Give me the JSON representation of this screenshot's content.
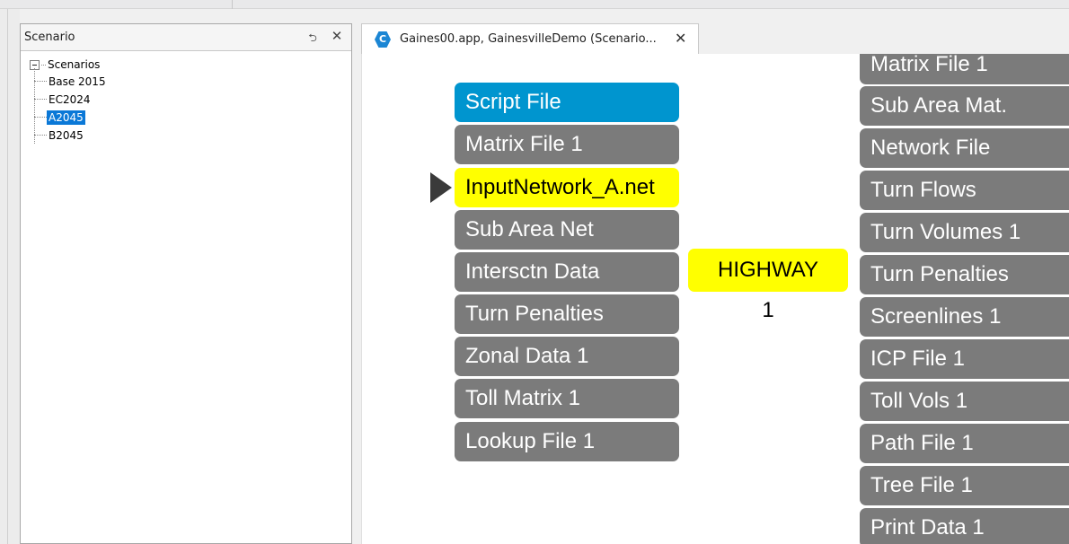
{
  "scenario_panel": {
    "title": "Scenario",
    "pin_glyph": "⮌",
    "close_glyph": "✕",
    "tree": {
      "root_label": "Scenarios",
      "items": [
        {
          "label": "Base 2015",
          "selected": false
        },
        {
          "label": "EC2024",
          "selected": false
        },
        {
          "label": "A2045",
          "selected": true
        },
        {
          "label": "B2045",
          "selected": false
        }
      ]
    }
  },
  "document_tab": {
    "icon_letter": "C",
    "label": "Gaines00.app, GainesvilleDemo (Scenario...",
    "close_glyph": "✕"
  },
  "flowchart": {
    "input_files": [
      {
        "label": "Script File",
        "style": "script"
      },
      {
        "label": "Matrix File 1",
        "style": "normal"
      },
      {
        "label": "InputNetwork_A.net",
        "style": "highlight"
      },
      {
        "label": "Sub Area Net",
        "style": "normal"
      },
      {
        "label": "Intersctn Data",
        "style": "normal"
      },
      {
        "label": "Turn Penalties",
        "style": "normal"
      },
      {
        "label": "Zonal Data 1",
        "style": "normal"
      },
      {
        "label": "Toll Matrix 1",
        "style": "normal"
      },
      {
        "label": "Lookup File 1",
        "style": "normal"
      }
    ],
    "step": {
      "label": "HIGHWAY",
      "number": "1"
    },
    "output_files": [
      {
        "label": "Matrix File 1"
      },
      {
        "label": "Sub Area Mat."
      },
      {
        "label": "Network File"
      },
      {
        "label": "Turn Flows"
      },
      {
        "label": "Turn Volumes 1"
      },
      {
        "label": "Turn Penalties"
      },
      {
        "label": "Screenlines 1"
      },
      {
        "label": "ICP File 1"
      },
      {
        "label": "Toll Vols 1"
      },
      {
        "label": "Path File 1"
      },
      {
        "label": "Tree File 1"
      },
      {
        "label": "Print Data 1"
      }
    ]
  },
  "colors": {
    "script_slot": "#0095cf",
    "file_slot": "#7b7b7b",
    "highlight": "#ffff00",
    "selection": "#0a78d7"
  }
}
